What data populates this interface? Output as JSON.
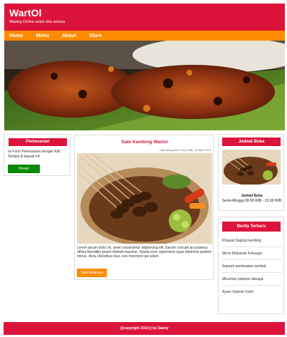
{
  "header": {
    "brand": "WartOl",
    "tagline": "Warteg Online untuk kita semua"
  },
  "nav": {
    "items": [
      {
        "label": "Home"
      },
      {
        "label": "Menu"
      },
      {
        "label": "About"
      },
      {
        "label": "Store"
      }
    ]
  },
  "colors": {
    "primary": "#dc143c",
    "accent": "#ff8c00",
    "button_green": "#0a8a0a"
  },
  "order_box": {
    "title": "Pemesanan",
    "text": "Isi Form Pemesanan dengan Klik Tombol di bawah ini!",
    "button": "Pesan"
  },
  "article": {
    "title": "Sate Kambing Wartol",
    "meta": "Diposting pada 11:04 WIB, 29 April 2019",
    "body": "Lorem ipsum dolor sit, amet consectetur adipisicing elit. Earum corrupti accusamus officia blanditiis ipsam deleniti maxime. Soluta error asperiores quas distinctio quidem minus, dicta, doloribus eius, eos inventore qui ullam.",
    "button": "Selengkapnya"
  },
  "schedule": {
    "title": "Jadwal Buka",
    "label": "Jadwal Buka",
    "hours": "Senin-Minggu 08.00 WIB - 22.00 WIB"
  },
  "news": {
    "title": "Berita Terbaru",
    "items": [
      {
        "label": "Khasiat Daging Kambing"
      },
      {
        "label": "Menu Makanan Keluarga"
      },
      {
        "label": "Sejarah pembuatan sambal"
      },
      {
        "label": "Minuman pelepas dahaga"
      },
      {
        "label": "Ayam Geprek Gurih"
      }
    ]
  },
  "footer": {
    "text": "@copyright 2019 || by Danny"
  }
}
